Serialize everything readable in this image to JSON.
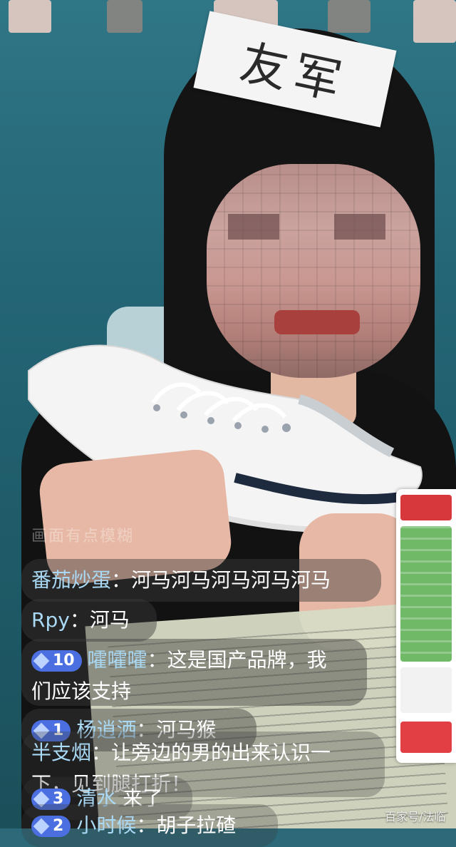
{
  "sign": {
    "text": "友军"
  },
  "chat": {
    "faded_line": "画面有点模糊",
    "messages": [
      {
        "user": "番茄炒蛋",
        "sep": "：",
        "text": "河马河马河马河马河马",
        "level": null
      },
      {
        "user": "Rpy",
        "sep": "：",
        "text": "河马",
        "level": null
      },
      {
        "user": "嚯嚯嚯",
        "sep": "：",
        "text": "这是国产品牌，我",
        "text2": "们应该支持",
        "level": "10"
      },
      {
        "user": "杨逍洒",
        "sep": "：",
        "text": "河马猴",
        "level": "1"
      },
      {
        "user": "半支烟",
        "sep": "：",
        "text": "让旁边的男的出来认识一",
        "text2": "下，见到腿打折！",
        "level": null
      },
      {
        "user": "清水",
        "sep": " ",
        "text": "来了",
        "level": "3"
      },
      {
        "user": "小时候",
        "sep": "：",
        "text": "胡子拉碴",
        "level": "2"
      }
    ]
  },
  "watermark": "百家号/法临",
  "colors": {
    "username": "#a9d9f5",
    "level_badge": "#4b6fe0",
    "bubble": "rgba(60,60,60,0.45)"
  },
  "icons": [
    "diamond-level-icon"
  ]
}
